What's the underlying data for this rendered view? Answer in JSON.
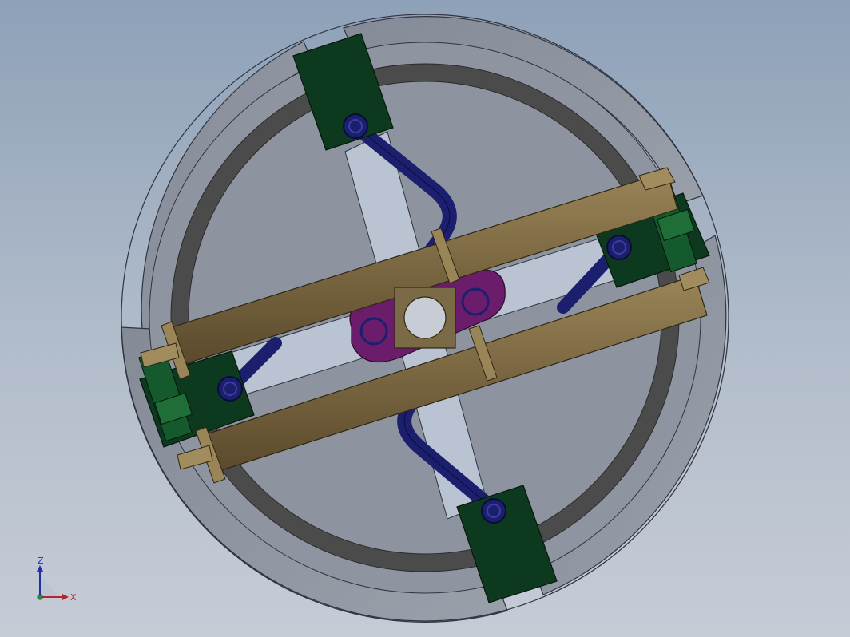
{
  "app": {
    "window_title": ""
  },
  "viewport": {
    "background_top": "#8ea1b8",
    "background_bottom": "#c6ccd6",
    "model": {
      "ring_color": "#8a919d",
      "ring_edge_color": "#2f3440",
      "inner_band_color": "#4b4b4b",
      "disc_color": "#8d94a0",
      "cross_arm_color": "#b9c3d2",
      "mount_block_color": "#0d3a1f",
      "connecting_link_color": "#1b1f6e",
      "cylinder_color": "#7d6943",
      "center_plate_color": "#6b1d6b",
      "center_hub_color": "#7a6a45"
    }
  },
  "triad": {
    "z_label": "Z",
    "x_label": "X",
    "z_color": "#1f2fa8",
    "x_color": "#b3262b"
  }
}
